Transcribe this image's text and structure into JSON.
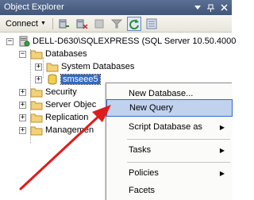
{
  "window": {
    "title": "Object Explorer"
  },
  "toolbar": {
    "connect_label": "Connect"
  },
  "tree": {
    "root": "DELL-D630\\SQLEXPRESS (SQL Server 10.50.4000",
    "databases": "Databases",
    "system_databases": "System Databases",
    "selected_db": "smseee5",
    "security": "Security",
    "server_objects": "Server Objec",
    "replication": "Replication",
    "management": "Managemen"
  },
  "context_menu": {
    "items": [
      {
        "label": "New Database..."
      },
      {
        "label": "New Query"
      },
      {
        "label": "Script Database as"
      },
      {
        "label": "Tasks"
      },
      {
        "label": "Policies"
      },
      {
        "label": "Facets"
      }
    ]
  },
  "colors": {
    "titlebar": "#4a5f84",
    "selection": "#316ac5",
    "menu_highlight": "#c1d2ee",
    "annotation_arrow": "#e01b1b"
  }
}
